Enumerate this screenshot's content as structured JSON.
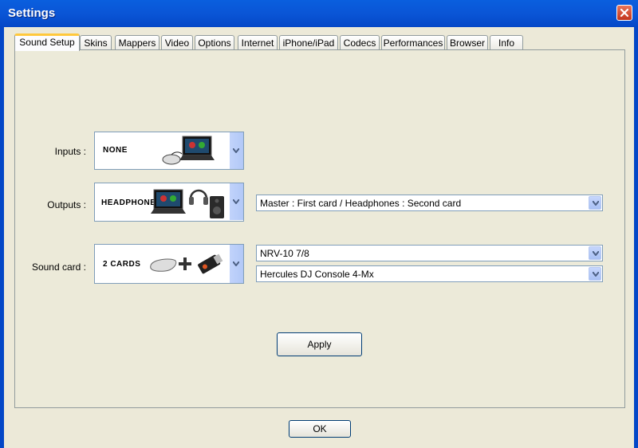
{
  "window": {
    "title": "Settings"
  },
  "tabs": [
    {
      "label": "Sound Setup",
      "active": true
    },
    {
      "label": "Skins"
    },
    {
      "label": "Mappers"
    },
    {
      "label": "Video"
    },
    {
      "label": "Options"
    },
    {
      "label": "Internet"
    },
    {
      "label": "iPhone/iPad"
    },
    {
      "label": "Codecs"
    },
    {
      "label": "Performances"
    },
    {
      "label": "Browser"
    },
    {
      "label": "Info"
    }
  ],
  "sound": {
    "inputs_label": "Inputs :",
    "inputs_value": "NONE",
    "outputs_label": "Outputs :",
    "outputs_value": "HEADPHONES",
    "outputs_combo": "Master : First card / Headphones : Second card",
    "soundcard_label": "Sound card :",
    "soundcard_value": "2 CARDS",
    "card1": "NRV-10 7/8",
    "card2": "Hercules DJ Console 4-Mx"
  },
  "buttons": {
    "apply": "Apply",
    "ok": "OK"
  },
  "colors": {
    "titlebar": "#0a55d6",
    "dialog_bg": "#ece9d8",
    "tab_highlight": "#ffc83c",
    "close": "#c2341b"
  },
  "icons": [
    "close-icon",
    "dropdown-arrow-icon",
    "laptop-icon",
    "mouse-icon",
    "headphones-icon",
    "speaker-icon",
    "usb-soundcard-icon",
    "plus-icon"
  ]
}
